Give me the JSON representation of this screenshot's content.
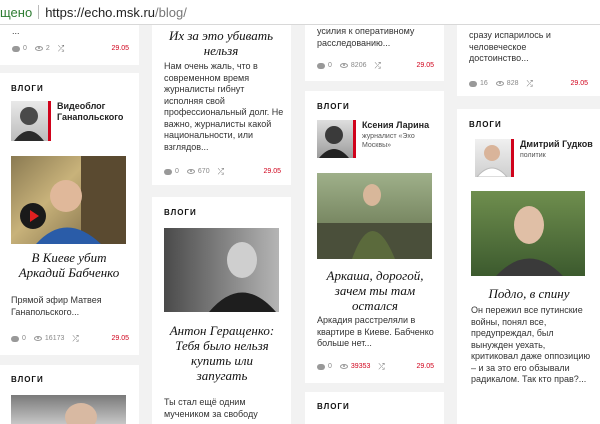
{
  "browser": {
    "security_text": "щено",
    "url_host": "https://echo.msk.ru",
    "url_path": "/blog/"
  },
  "col1_top": {
    "text": "...",
    "comments": "0",
    "views": "2",
    "date": "29.05"
  },
  "col1_card": {
    "label": "ВЛОГИ",
    "author": "Видеоблог Ганапольского",
    "title": "В Киеве убит Аркадий Бабченко",
    "text": "Прямой эфир Матвея Ганапольского...",
    "comments": "0",
    "views": "16173",
    "date": "29.05"
  },
  "col1_card2": {
    "label": "ВЛОГИ"
  },
  "col2_top": {
    "title": "Их за это убивать нельзя",
    "text": "Нам очень жаль, что в современном время журналисты гибнут исполняя свой профессиональный долг. Не важно, журналисты какой национальности, или взглядов...",
    "comments": "0",
    "views": "670",
    "date": "29.05"
  },
  "col2_card": {
    "label": "ВЛОГИ",
    "title": "Антон Геращенко: Тебя было нельзя купить или запугать",
    "text": "Ты стал ещё одним мучеником за свободу"
  },
  "col3_top": {
    "text": "усилия к оперативному расследованию...",
    "comments": "0",
    "views": "8206",
    "date": "29.05"
  },
  "col3_card": {
    "label": "ВЛОГИ",
    "author": "Ксения Ларина",
    "role": "журналист «Эхо Москвы»",
    "title": "Аркаша, дорогой, зачем ты там остался",
    "text": "Аркадия расстреляли в квартире в Киеве. Бабченко больше нет...",
    "comments": "0",
    "views": "39353",
    "date": "29.05"
  },
  "col3_card2": {
    "label": "ВЛОГИ"
  },
  "col4_top": {
    "text": "сразу испарилось и человеческое достоинство...",
    "comments": "16",
    "views": "828",
    "date": "29.05"
  },
  "col4_card": {
    "label": "ВЛОГИ",
    "author": "Дмитрий Гудков",
    "role": "политик",
    "title": "Подло, в спину",
    "text": "Он пережил все путинские войны, понял все, предупреждал, был вынужден уехать, критиковал даже оппозицию – и за это его обзывали радикалом. Так кто прав?..."
  },
  "icons": {
    "comment": "comment-icon",
    "view": "eye-icon",
    "share": "share-icon",
    "play": "play-icon"
  },
  "colors": {
    "date_red": "#d0021b",
    "accent_red": "#d0021b",
    "secure_green": "#2e7d32",
    "page_bg": "#f2f2f2"
  }
}
